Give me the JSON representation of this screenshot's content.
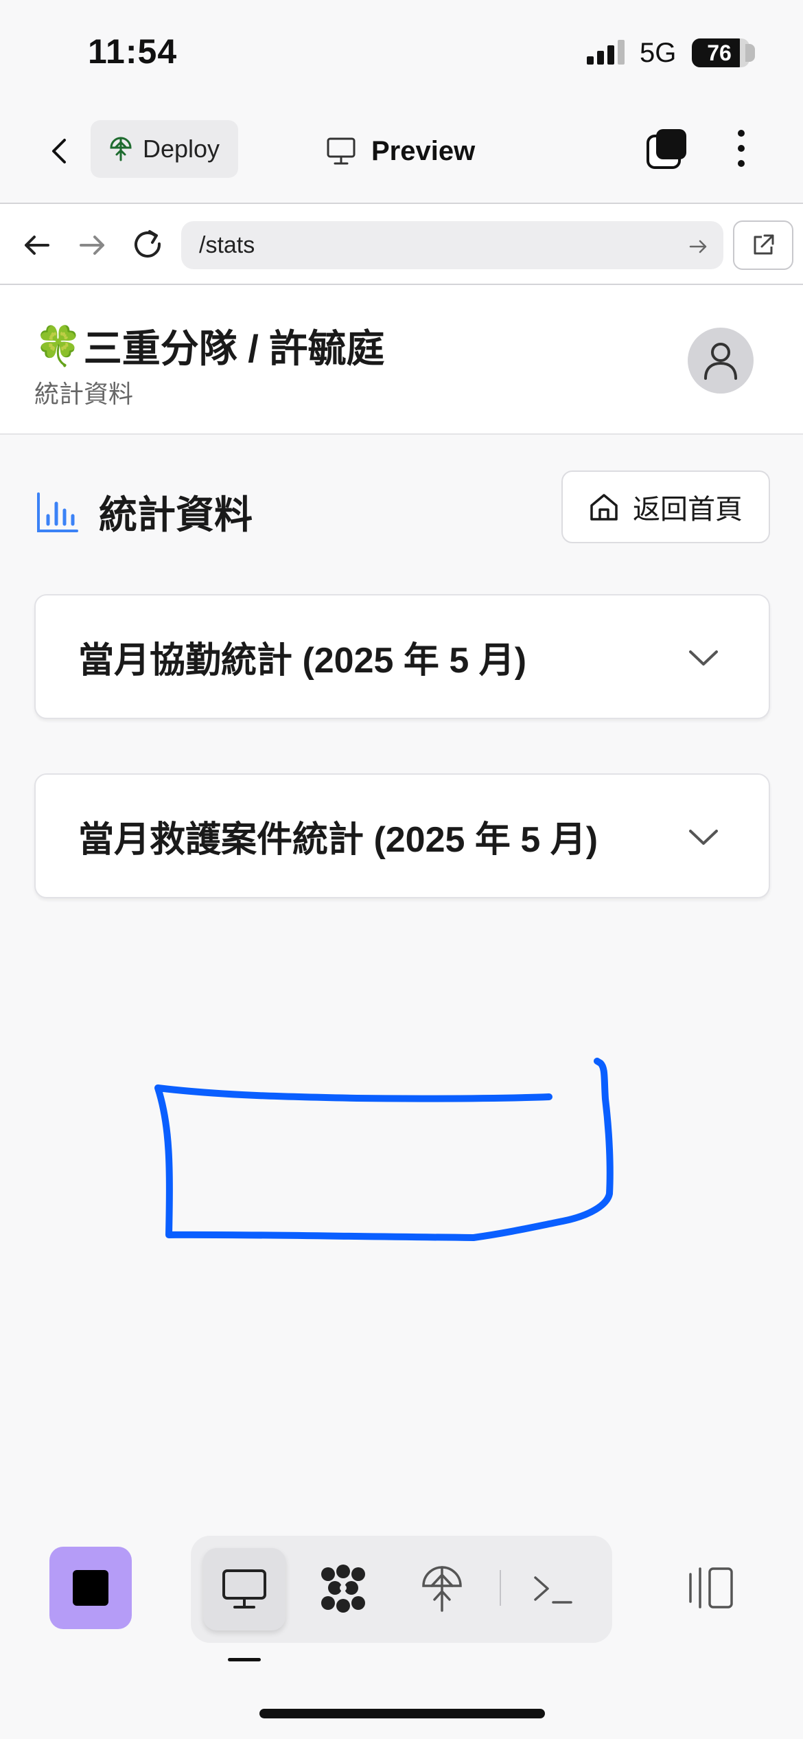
{
  "status_bar": {
    "time": "11:54",
    "network": "5G",
    "battery": "76"
  },
  "app_bar": {
    "deploy_label": "Deploy",
    "preview_label": "Preview"
  },
  "browser": {
    "url": "/stats"
  },
  "site": {
    "title": "三重分隊 / 許毓庭",
    "subtitle": "統計資料",
    "clover_icon": "🍀"
  },
  "page": {
    "heading": "統計資料",
    "home_button": "返回首頁"
  },
  "accordions": [
    {
      "label": "當月協勤統計 (2025 年 5 月)"
    },
    {
      "label": "當月救護案件統計 (2025 年 5 月)"
    }
  ],
  "annotation": {
    "color": "#0a5fff"
  },
  "bottom_tabs": [
    "preview-icon",
    "agent-icon",
    "deploy-icon",
    "terminal-icon"
  ],
  "colors": {
    "accent": "#3b82f6",
    "stop_button": "#b59cf7"
  }
}
